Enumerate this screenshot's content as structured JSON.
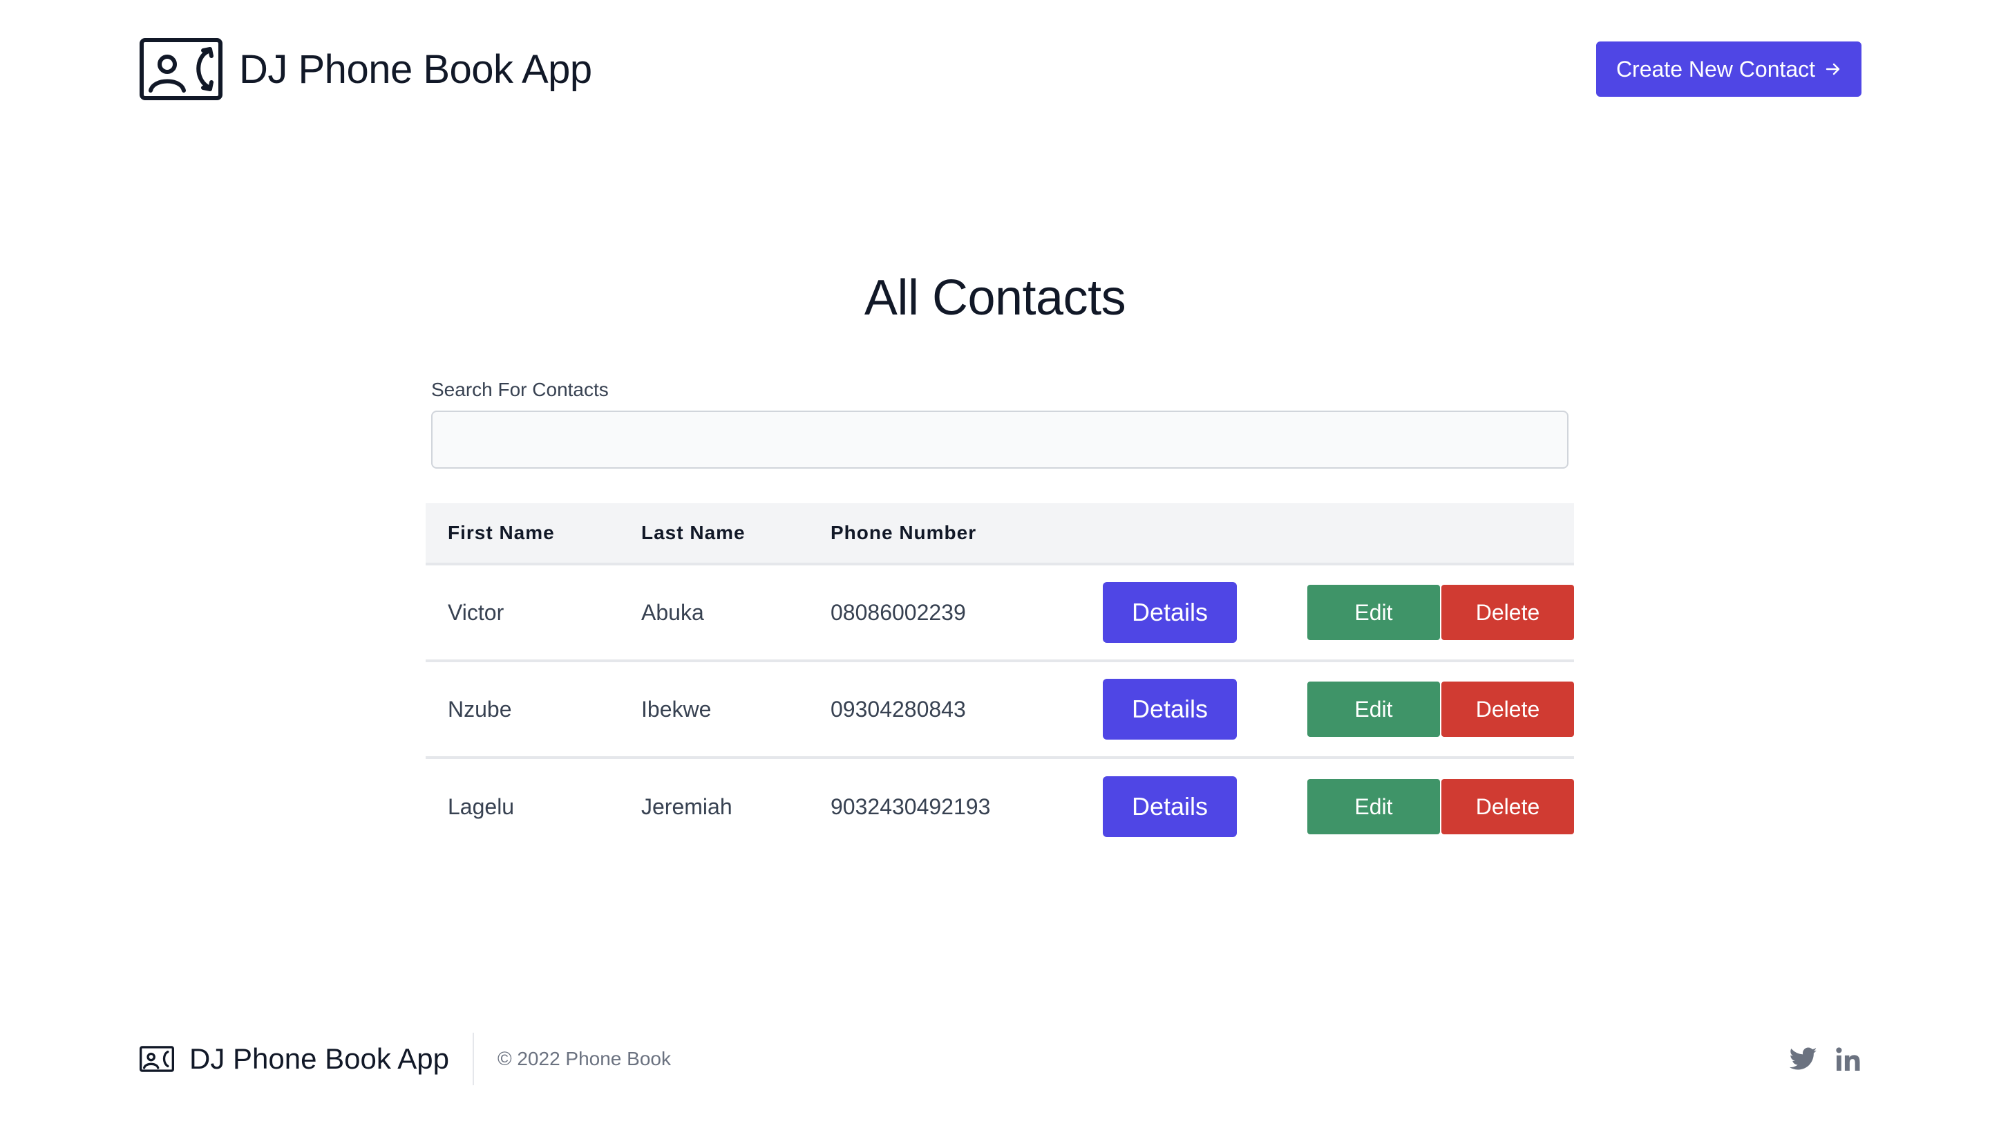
{
  "header": {
    "brand_title": "DJ Phone Book App",
    "brand_logo_icon": "contact-card-phone-icon",
    "create_button_label": "Create New Contact",
    "create_button_icon": "arrow-right-icon"
  },
  "main": {
    "title": "All Contacts",
    "search": {
      "label": "Search For Contacts",
      "value": "",
      "placeholder": ""
    },
    "table": {
      "columns": [
        "First Name",
        "Last Name",
        "Phone Number"
      ],
      "rows": [
        {
          "first_name": "Victor",
          "last_name": "Abuka",
          "phone": "08086002239",
          "details_label": "Details",
          "edit_label": "Edit",
          "delete_label": "Delete"
        },
        {
          "first_name": "Nzube",
          "last_name": "Ibekwe",
          "phone": "09304280843",
          "details_label": "Details",
          "edit_label": "Edit",
          "delete_label": "Delete"
        },
        {
          "first_name": "Lagelu",
          "last_name": "Jeremiah",
          "phone": "9032430492193",
          "details_label": "Details",
          "edit_label": "Edit",
          "delete_label": "Delete"
        }
      ]
    }
  },
  "footer": {
    "brand_title": "DJ Phone Book App",
    "copyright": "© 2022 Phone Book",
    "social_icons": [
      "twitter-icon",
      "linkedin-icon"
    ]
  },
  "colors": {
    "primary": "#4f46e5",
    "edit": "#3f9468",
    "delete": "#d03b32",
    "table_header_bg": "#f3f4f6",
    "text": "#111827"
  }
}
